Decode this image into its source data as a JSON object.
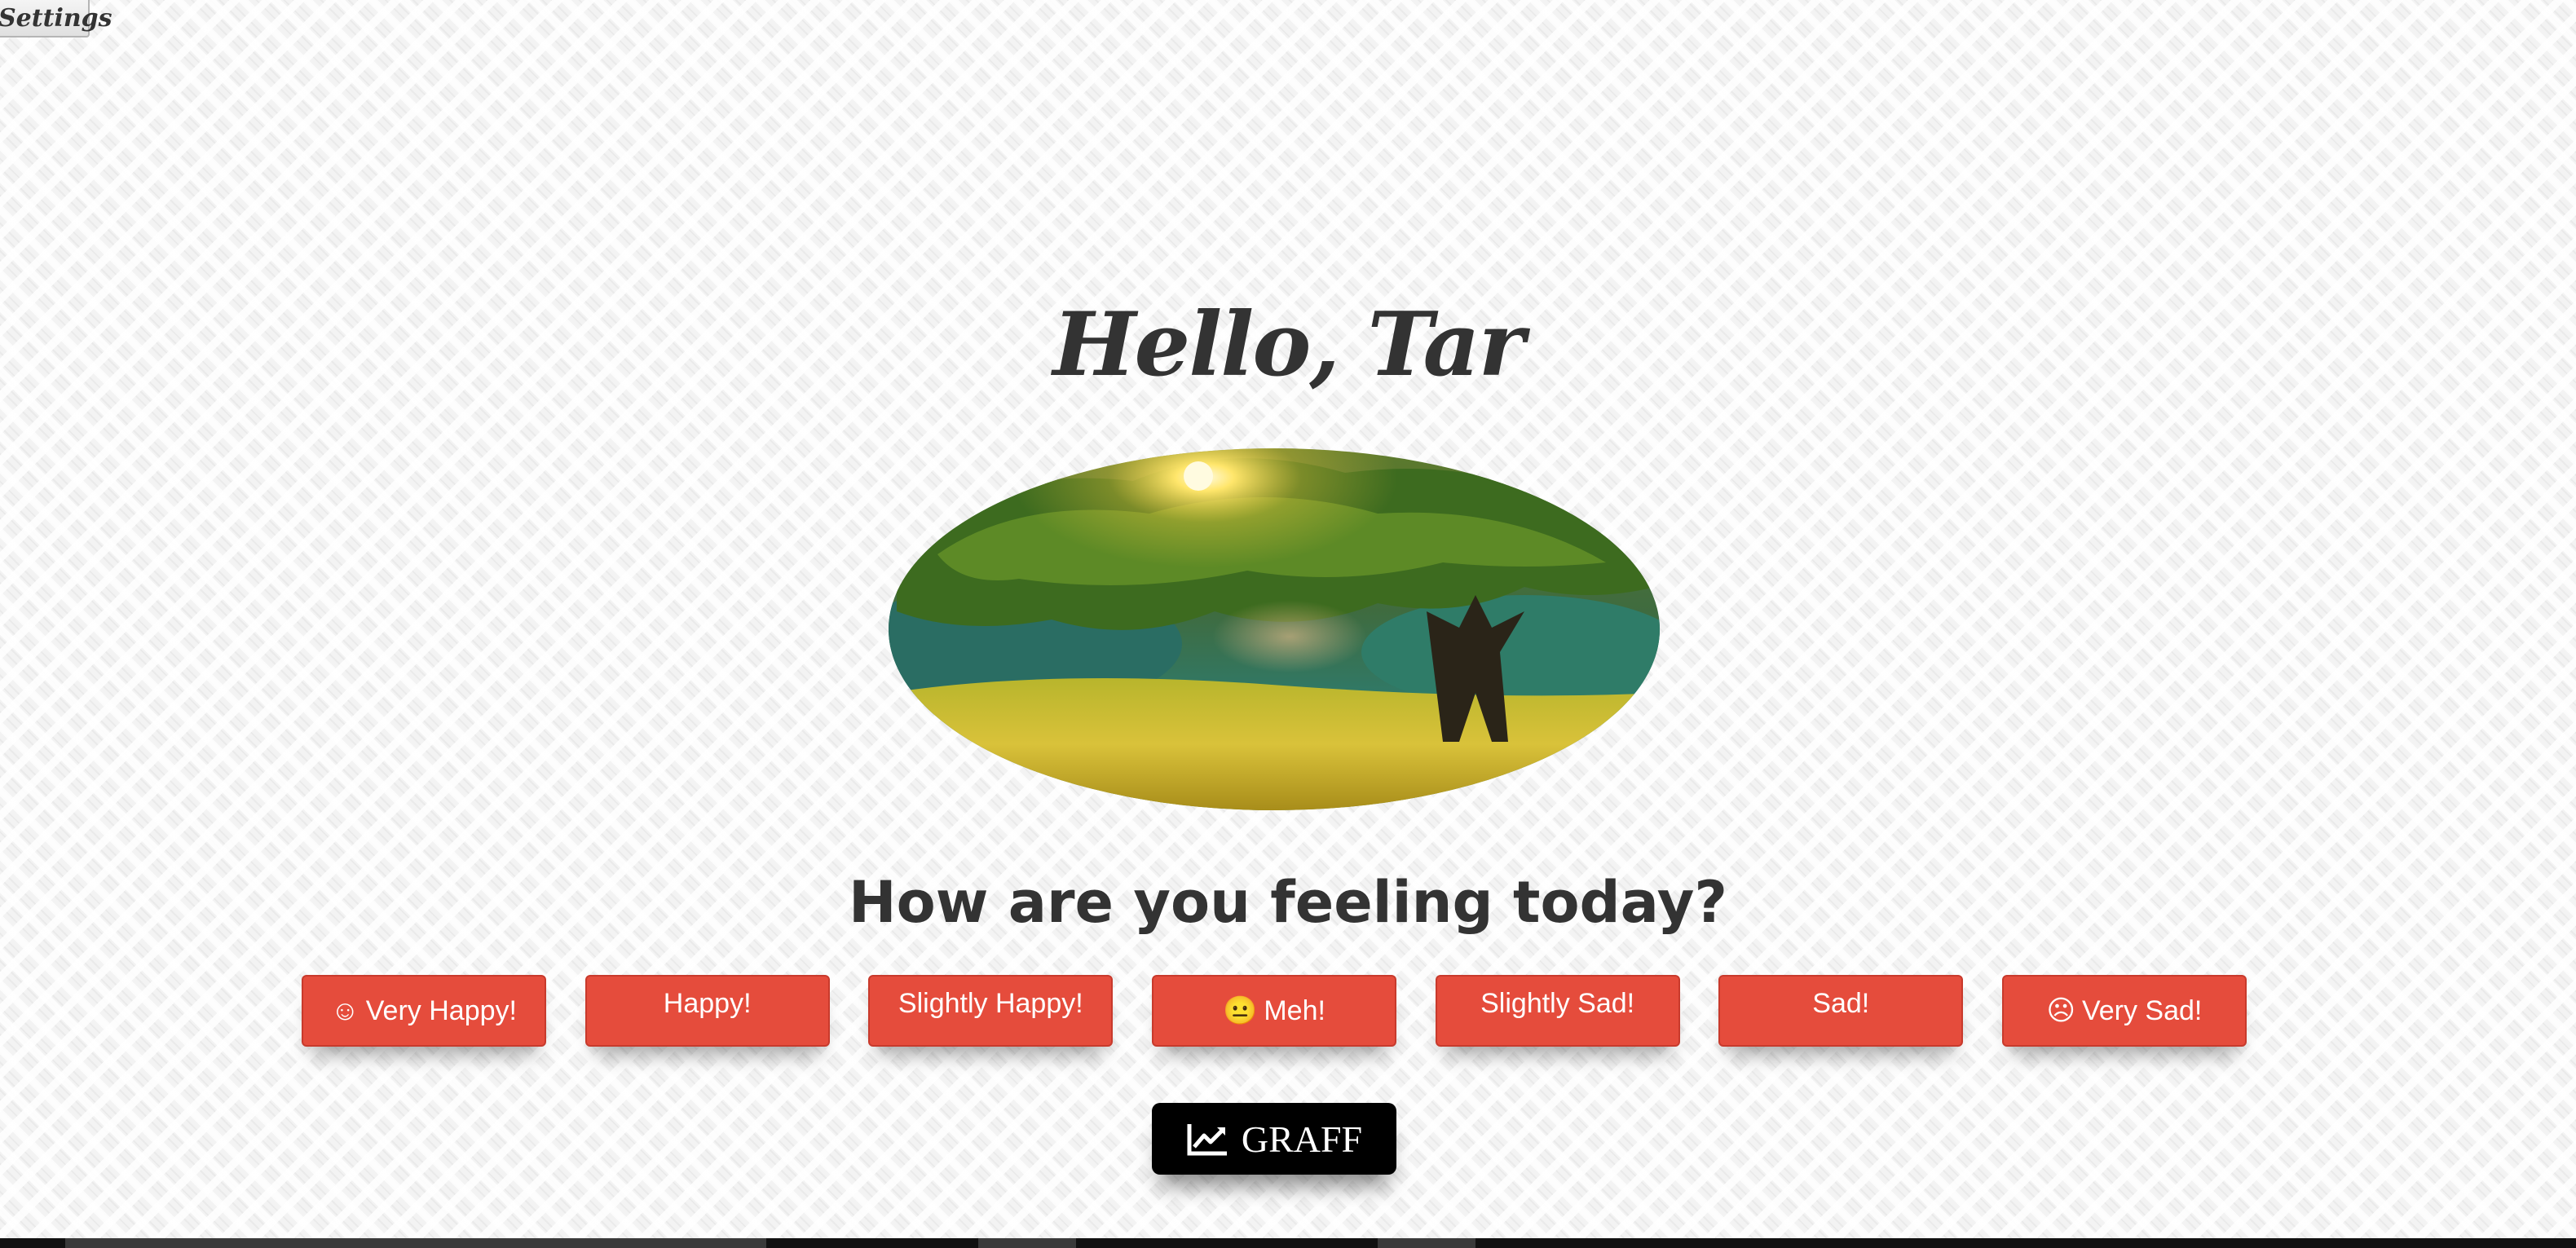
{
  "settings": {
    "label": "Settings"
  },
  "greeting": {
    "text": "Hello, Tar"
  },
  "hero": {
    "description_icon": "tree-sunset-image"
  },
  "question": {
    "text": "How are you feeling today?"
  },
  "moods": [
    {
      "label": "Very Happy!",
      "face": "☺"
    },
    {
      "label": "Happy!",
      "face": ""
    },
    {
      "label": "Slightly Happy!",
      "face": ""
    },
    {
      "label": "Meh!",
      "face": "😐"
    },
    {
      "label": "Slightly Sad!",
      "face": ""
    },
    {
      "label": "Sad!",
      "face": ""
    },
    {
      "label": "Very Sad!",
      "face": "☹"
    }
  ],
  "graff": {
    "label": "GRAFF",
    "icon": "line-chart-icon"
  },
  "colors": {
    "mood_button": "#e54c3c",
    "graff_button": "#000000",
    "text": "#333333"
  }
}
